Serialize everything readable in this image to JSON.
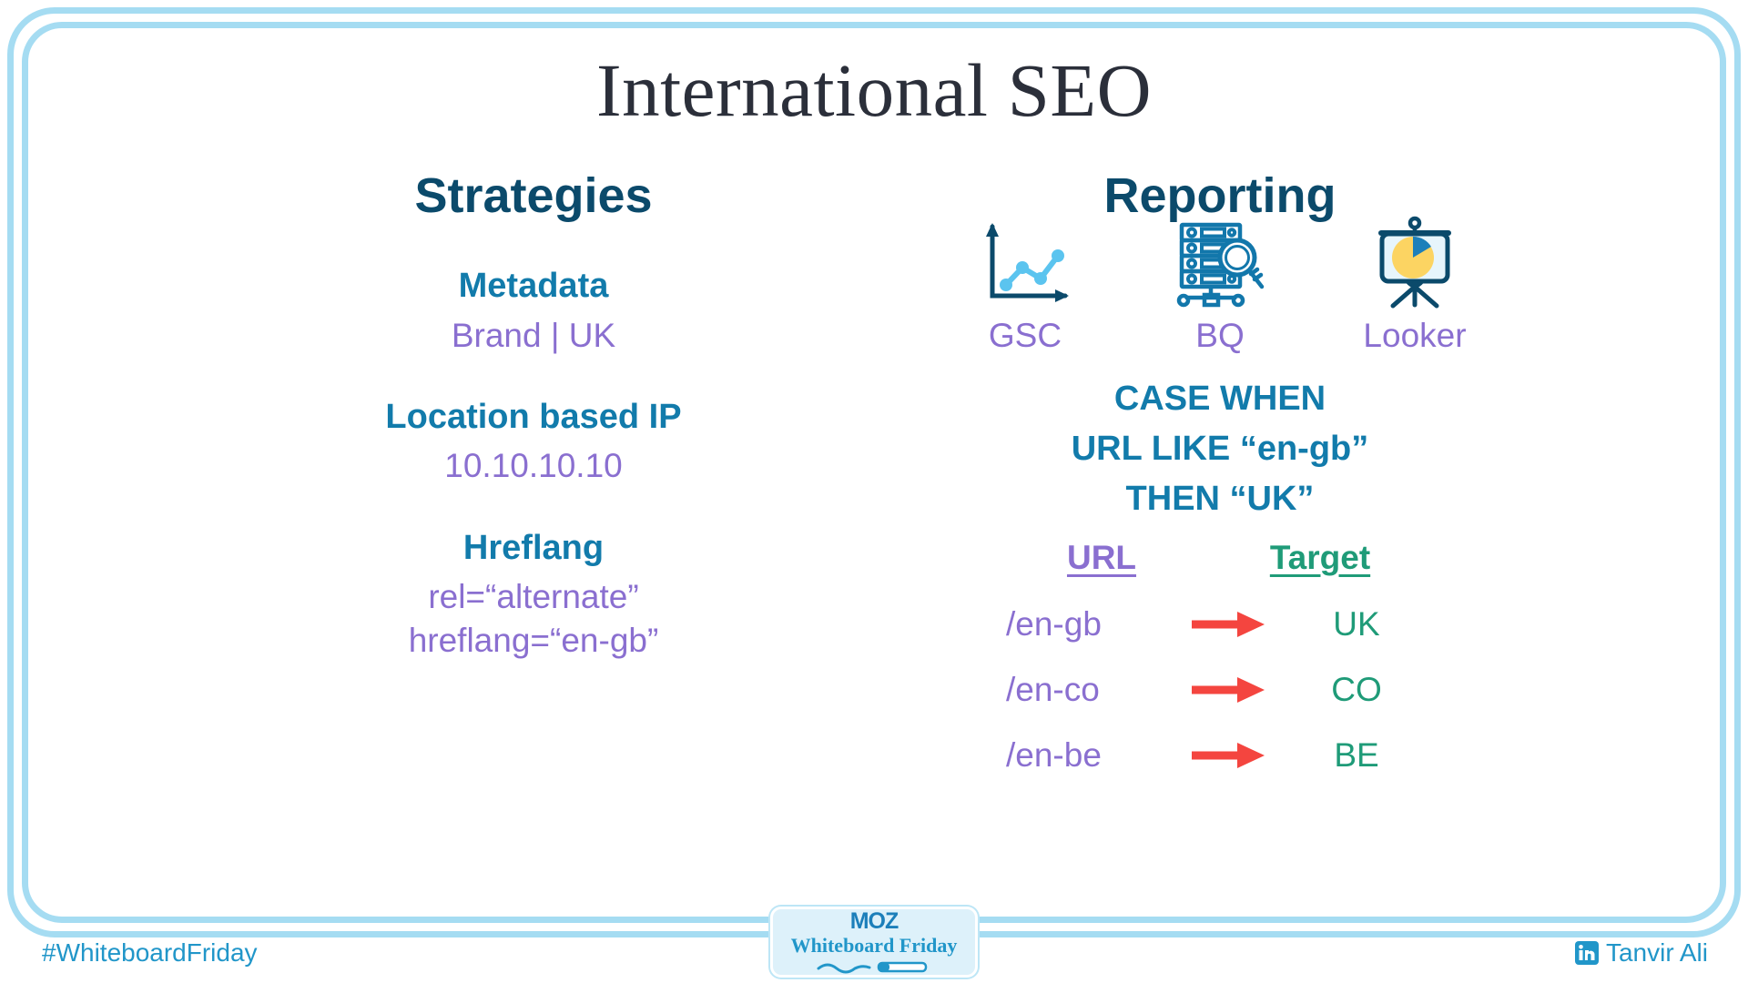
{
  "title": "International SEO",
  "columns": {
    "strategies": {
      "heading": "Strategies",
      "blocks": [
        {
          "title": "Metadata",
          "value_lines": [
            "Brand | UK"
          ]
        },
        {
          "title": "Location based IP",
          "value_lines": [
            "10.10.10.10"
          ]
        },
        {
          "title": "Hreflang",
          "value_lines": [
            "rel=“alternate”",
            "hreflang=“en-gb”"
          ]
        }
      ]
    },
    "reporting": {
      "heading": "Reporting",
      "tools": [
        {
          "label": "GSC",
          "icon": "line-chart-icon"
        },
        {
          "label": "BQ",
          "icon": "database-search-icon"
        },
        {
          "label": "Looker",
          "icon": "presentation-pie-chart-icon"
        }
      ],
      "sql_lines": [
        "CASE WHEN",
        "URL LIKE “en-gb”",
        "THEN “UK”"
      ],
      "mapping": {
        "header_url": "URL",
        "header_target": "Target",
        "rows": [
          {
            "url": "/en-gb",
            "target": "UK"
          },
          {
            "url": "/en-co",
            "target": "CO"
          },
          {
            "url": "/en-be",
            "target": "BE"
          }
        ]
      }
    }
  },
  "footer": {
    "hashtag": "#WhiteboardFriday",
    "author": "Tanvir Ali",
    "author_icon": "linkedin-icon",
    "badge": {
      "brand": "MOZ",
      "series": "Whiteboard Friday"
    }
  },
  "colors": {
    "frame": "#a5dcf2",
    "title": "#2b2f3a",
    "heading": "#0b4a6b",
    "subhead": "#127bab",
    "value": "#8a6fd0",
    "target": "#1f9b78",
    "arrow": "#f4453f",
    "footer": "#2196c9",
    "icon_dark": "#0b4a6b",
    "icon_blue": "#1c7fba",
    "icon_light_blue": "#5bc4ef",
    "icon_yellow": "#fcd462"
  }
}
